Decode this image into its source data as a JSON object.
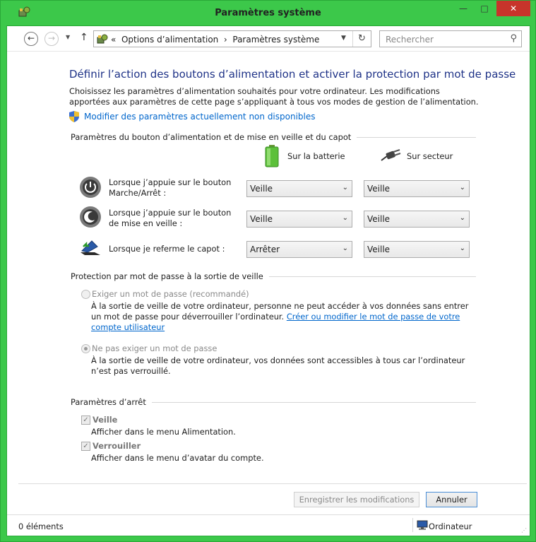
{
  "window": {
    "title": "Paramètres système"
  },
  "titlebar_buttons": {
    "minimize": "—",
    "maximize": "□",
    "close": "✕"
  },
  "nav": {
    "back": "←",
    "forward": "→",
    "recent": "▼",
    "up": "↑",
    "breadcrumb": [
      "Options d’alimentation",
      "Paramètres système"
    ],
    "breadcrumb_prefix": "«",
    "separator": "›",
    "dropdown": "▼",
    "refresh": "↻",
    "search_placeholder": "Rechercher",
    "search_icon": "⚲"
  },
  "page": {
    "heading": "Définir l’action des boutons d’alimentation et activer la protection par mot de passe",
    "intro": "Choisissez les paramètres d’alimentation souhaités pour votre ordinateur. Les modifications apportées aux paramètres de cette page s’appliquant à tous vos modes de gestion de l’alimentation.",
    "unavailable_link": "Modifier des paramètres actuellement non disponibles"
  },
  "buttons_section": {
    "title": "Paramètres du bouton d’alimentation et de mise en veille et du capot",
    "col_battery": "Sur la batterie",
    "col_ac": "Sur secteur",
    "rows": [
      {
        "label": "Lorsque j’appuie sur le bouton Marche/Arrêt :",
        "battery": "Veille",
        "ac": "Veille",
        "icon": "power-button"
      },
      {
        "label": "Lorsque j’appuie sur le bouton de mise en veille :",
        "battery": "Veille",
        "ac": "Veille",
        "icon": "sleep-button"
      },
      {
        "label": "Lorsque je referme le capot :",
        "battery": "Arrêter",
        "ac": "Veille",
        "icon": "laptop-lid"
      }
    ],
    "chevron": "⌄"
  },
  "password_section": {
    "title": "Protection par mot de passe à la sortie de veille",
    "option1_label": "Exiger un mot de passe (recommandé)",
    "option1_desc": "À la sortie de veille de votre ordinateur, personne ne peut accéder à vos données sans entrer un mot de passe pour déverrouiller l’ordinateur.",
    "option1_link": "Créer ou modifier le mot de passe de votre compte utilisateur",
    "option2_label": "Ne pas exiger un mot de passe",
    "option2_desc": "À la sortie de veille de votre ordinateur, vos données sont accessibles à tous car l’ordinateur n’est pas verrouillé."
  },
  "shutdown_section": {
    "title": "Paramètres d’arrêt",
    "items": [
      {
        "label": "Veille",
        "desc": "Afficher dans le menu Alimentation.",
        "checked": true
      },
      {
        "label": "Verrouiller",
        "desc": "Afficher dans le menu d’avatar du compte.",
        "checked": true
      }
    ],
    "checkmark": "✓"
  },
  "footer": {
    "save": "Enregistrer les modifications",
    "cancel": "Annuler"
  },
  "status": {
    "items": "0 éléments",
    "location": "Ordinateur",
    "grip": "⋰"
  }
}
